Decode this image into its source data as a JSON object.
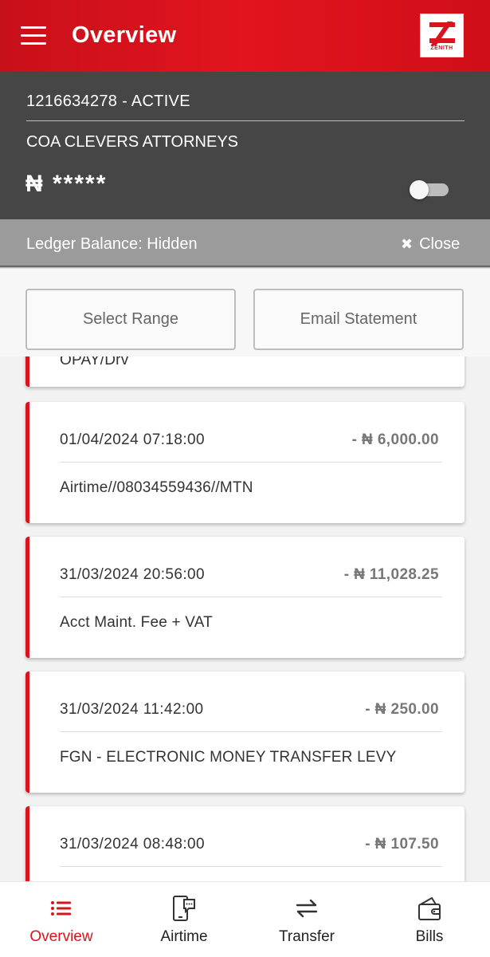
{
  "header": {
    "title": "Overview",
    "logo_text": "ZENITH"
  },
  "account": {
    "number_status": "1216634278  - ACTIVE",
    "name": "COA CLEVERS ATTORNEYS",
    "balance": "₦ *****"
  },
  "ledger": {
    "text": "Ledger Balance: Hidden",
    "close_label": "Close"
  },
  "actions": {
    "select_range": "Select Range",
    "email_statement": "Email Statement"
  },
  "transactions": [
    {
      "date": "",
      "amount": "",
      "description": "OPAY/Drv"
    },
    {
      "date": "01/04/2024 07:18:00",
      "amount": "- ₦ 6,000.00",
      "description": "Airtime//08034559436//MTN"
    },
    {
      "date": "31/03/2024 20:56:00",
      "amount": "- ₦ 11,028.25",
      "description": "Acct Maint. Fee + VAT"
    },
    {
      "date": "31/03/2024 11:42:00",
      "amount": "- ₦ 250.00",
      "description": "FGN - ELECTRONIC MONEY TRANSFER LEVY"
    },
    {
      "date": "31/03/2024 08:48:00",
      "amount": "- ₦ 107.50",
      "description": ""
    }
  ],
  "nav": {
    "overview": "Overview",
    "airtime": "Airtime",
    "transfer": "Transfer",
    "bills": "Bills"
  },
  "colors": {
    "brand_red": "#d8141e",
    "panel_dark": "#464646",
    "ledger_gray": "#9b9b9b"
  }
}
